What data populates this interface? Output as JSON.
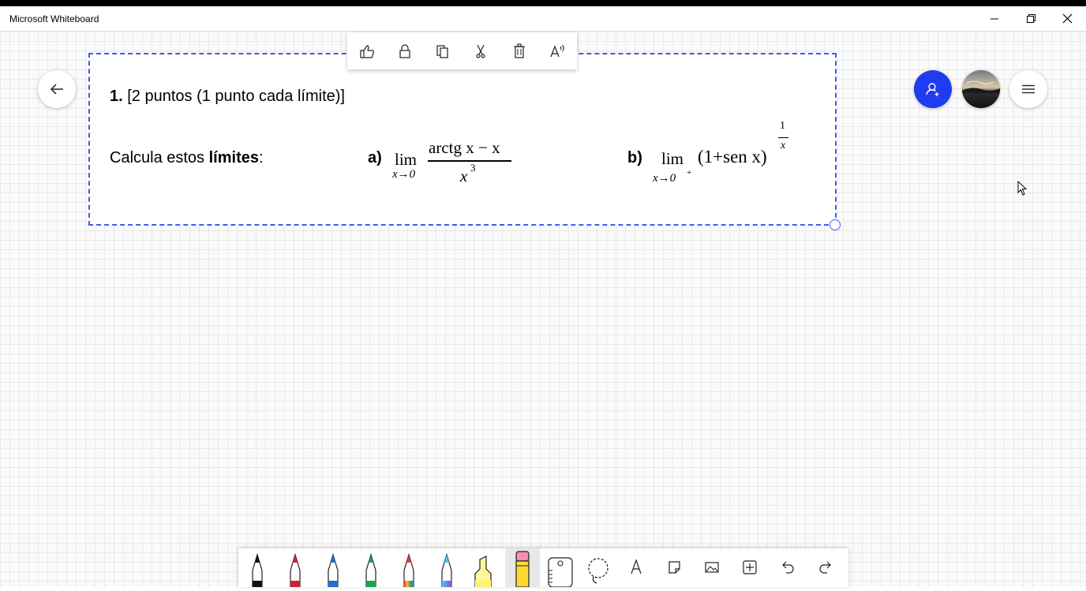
{
  "window": {
    "title": "Microsoft Whiteboard",
    "controls": [
      "minimize-icon",
      "restore-icon",
      "close-icon"
    ]
  },
  "context_toolbar": {
    "items": [
      "thumbs-up-icon",
      "lock-icon",
      "copy-icon",
      "cut-icon",
      "delete-icon",
      "read-aloud-icon"
    ]
  },
  "content": {
    "question_number": "1.",
    "question_points": "[2 puntos (1 punto cada límite)]",
    "instruction_prefix": "Calcula estos ",
    "instruction_bold": "límites",
    "instruction_suffix": ":",
    "part_a": {
      "label": "a)",
      "lim": "lim",
      "sub": "x→0",
      "numerator": "arctg x − x",
      "denominator_base": "x",
      "denominator_exp": "3"
    },
    "part_b": {
      "label": "b)",
      "lim": "lim",
      "sub": "x→0",
      "sub_sup": "+",
      "expression": "(1+sen x)",
      "exp_num": "1",
      "exp_den": "x"
    }
  },
  "right_buttons": [
    "share-icon",
    "avatar",
    "hamburger-menu-icon"
  ],
  "pen_toolbar": {
    "items": [
      "black-pen",
      "red-pen",
      "blue-pen",
      "green-pen",
      "rainbow-pen",
      "galaxy-pen",
      "highlighter",
      "eraser",
      "ruler",
      "lasso",
      "text-icon",
      "note-icon",
      "image-icon",
      "insert-icon",
      "undo-icon",
      "redo-icon"
    ],
    "active": "eraser"
  },
  "colors": {
    "selection": "#3d5afe",
    "share_button": "#1f3cf0"
  }
}
